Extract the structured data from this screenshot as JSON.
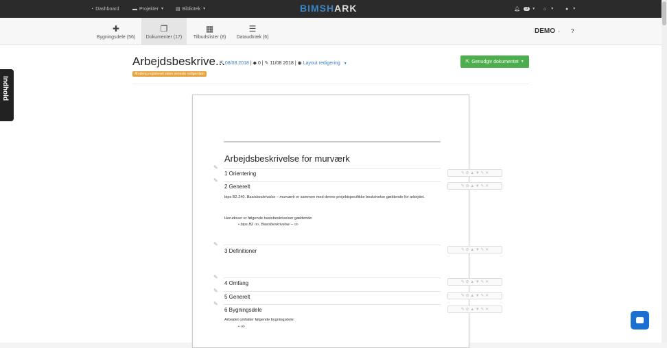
{
  "topbar": {
    "dashboard": "Dashboard",
    "projects": "Projekter",
    "library": "Bibliotek",
    "logo_a": "BIMSH",
    "logo_b": "ARK",
    "notifications": "0"
  },
  "tabs": [
    {
      "label": "Bygningsdele (56)",
      "icon": "puzzle-icon"
    },
    {
      "label": "Dokumenter (17)",
      "icon": "documents-icon"
    },
    {
      "label": "Tilbudslister (8)",
      "icon": "table-icon"
    },
    {
      "label": "Dataudtræk (6)",
      "icon": "database-icon"
    }
  ],
  "account": {
    "demo": "DEMO"
  },
  "side_tab": "Indhold",
  "document": {
    "title": "Arbejdsbeskrive...",
    "created": "08/08.2018",
    "count": "0",
    "edited": "11/08 2018",
    "layout": "Layout redigering",
    "warning": "Ændring registreret siden seneste redigerdato",
    "regenerate": "Genudgiv dokumentet"
  },
  "page": {
    "heading": "Arbejdsbeskrivelse for murværk",
    "sections": [
      {
        "title": "1 Orientering"
      },
      {
        "title": "2 Generelt"
      },
      {
        "title": "3 Definitioner"
      },
      {
        "title": "4 Omfang"
      },
      {
        "title": "5 Generelt"
      },
      {
        "title": "6 Bygningsdele"
      }
    ],
    "text1_a": "bips B2.240.",
    "text1_b": "Basisbeskrivelse – murværk",
    "text1_c": "er sammen med denne projektspecifikke beskrivelse gældende for arbejdet.",
    "text2": "Herudover er følgende basisbeskrivelser gældende:",
    "bullet1_a": "bips B2 ‹x›,",
    "bullet1_b": "Basisbeskrivelse – ‹x›",
    "text3": "Arbejdet omfatter følgende bygningsdele:",
    "bullet2": "‹x›"
  },
  "colors": {
    "brand": "#3b84c4",
    "success": "#4cae4c",
    "warning": "#e8a33d",
    "chat": "#1a6fd1"
  }
}
